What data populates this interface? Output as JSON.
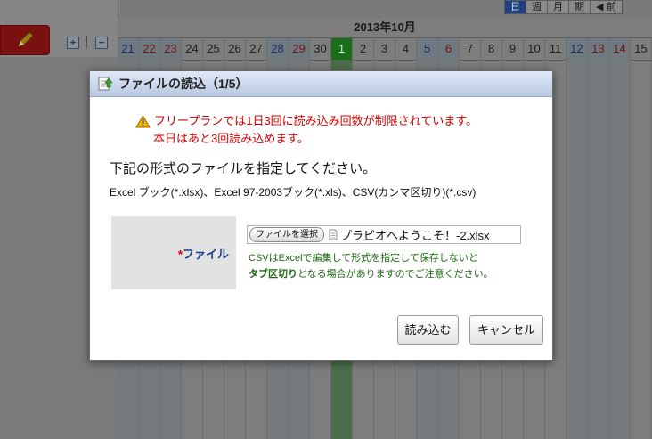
{
  "background": {
    "month": "2013年10月",
    "view_tabs": [
      {
        "label": "日",
        "active": true
      },
      {
        "label": "週",
        "active": false
      },
      {
        "label": "月",
        "active": false
      },
      {
        "label": "期",
        "active": false
      },
      {
        "label": "◀ 前",
        "active": false
      }
    ],
    "days": [
      {
        "n": "21",
        "kind": "sat"
      },
      {
        "n": "22",
        "kind": "sun"
      },
      {
        "n": "23",
        "kind": "sun"
      },
      {
        "n": "24",
        "kind": ""
      },
      {
        "n": "25",
        "kind": ""
      },
      {
        "n": "26",
        "kind": ""
      },
      {
        "n": "27",
        "kind": ""
      },
      {
        "n": "28",
        "kind": "sat"
      },
      {
        "n": "29",
        "kind": "sun"
      },
      {
        "n": "30",
        "kind": ""
      },
      {
        "n": "1",
        "kind": "today"
      },
      {
        "n": "2",
        "kind": ""
      },
      {
        "n": "3",
        "kind": ""
      },
      {
        "n": "4",
        "kind": ""
      },
      {
        "n": "5",
        "kind": "sat"
      },
      {
        "n": "6",
        "kind": "sun"
      },
      {
        "n": "7",
        "kind": ""
      },
      {
        "n": "8",
        "kind": ""
      },
      {
        "n": "9",
        "kind": ""
      },
      {
        "n": "10",
        "kind": ""
      },
      {
        "n": "11",
        "kind": ""
      },
      {
        "n": "12",
        "kind": "sat"
      },
      {
        "n": "13",
        "kind": "sun"
      },
      {
        "n": "14",
        "kind": "sun"
      },
      {
        "n": "15",
        "kind": ""
      }
    ],
    "expand_label": "+",
    "collapse_label": "−"
  },
  "dialog": {
    "title": "ファイルの読込（1/5）",
    "warning_line1": "フリープランでは1日3回に読み込み回数が制限されています。",
    "warning_line2": "本日はあと3回読み込めます。",
    "instruction": "下記の形式のファイルを指定してください。",
    "formats": "Excel ブック(*.xlsx)、Excel 97-2003ブック(*.xls)、CSV(カンマ区切り)(*.csv)",
    "file_field": {
      "required_mark": "*",
      "label": "ファイル",
      "choose_button": "ファイルを選択",
      "selected_file": "プラビオへようこそ！-2.xlsx"
    },
    "csv_note_line1": "CSVはExcelで編集して形式を指定して保存しないと",
    "csv_note_bold": "タブ区切り",
    "csv_note_line2": "となる場合がありますのでご注意ください。",
    "load_button": "読み込む",
    "cancel_button": "キャンセル"
  },
  "colors": {
    "warning": "#d40000",
    "label": "#1a3c8a",
    "note": "#1e6a12",
    "title_bar": "#c6d4ea"
  }
}
